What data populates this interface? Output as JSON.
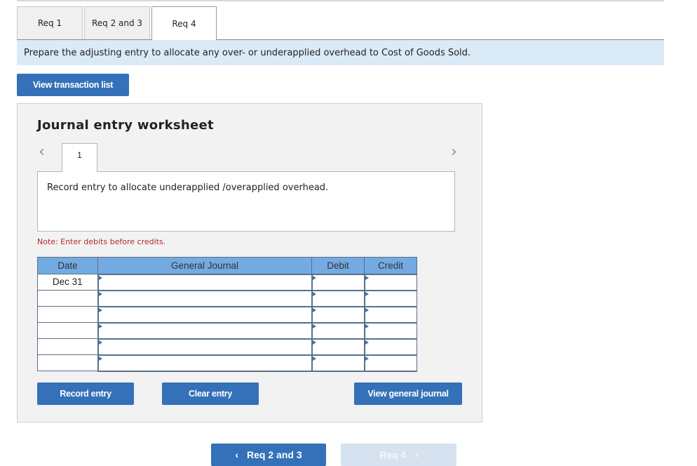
{
  "tabs": [
    {
      "label": "Req 1",
      "active": false
    },
    {
      "label": "Req 2 and 3",
      "active": false
    },
    {
      "label": "Req 4",
      "active": true
    }
  ],
  "prompt": "Prepare the adjusting entry to allocate any over- or underapplied overhead to Cost of Goods Sold.",
  "view_transaction_list_label": "View transaction list",
  "worksheet": {
    "title": "Journal entry worksheet",
    "prev_icon": "chevron-left-icon",
    "next_icon": "chevron-right-icon",
    "entry_tab": "1",
    "description": "Record entry to allocate underapplied /overapplied overhead.",
    "note": "Note: Enter debits before credits.",
    "columns": [
      "Date",
      "General Journal",
      "Debit",
      "Credit"
    ],
    "rows": [
      {
        "date": "Dec 31",
        "account": "",
        "debit": "",
        "credit": ""
      },
      {
        "date": "",
        "account": "",
        "debit": "",
        "credit": ""
      },
      {
        "date": "",
        "account": "",
        "debit": "",
        "credit": ""
      },
      {
        "date": "",
        "account": "",
        "debit": "",
        "credit": ""
      },
      {
        "date": "",
        "account": "",
        "debit": "",
        "credit": ""
      },
      {
        "date": "",
        "account": "",
        "debit": "",
        "credit": ""
      }
    ],
    "buttons": {
      "record": "Record entry",
      "clear": "Clear entry",
      "view_general_journal": "View general journal"
    }
  },
  "nav": {
    "prev_label": "Req 2 and 3",
    "next_label": "Req 4",
    "prev_chevron": "‹",
    "next_chevron": "›"
  },
  "colors": {
    "accent": "#3471b8",
    "header_blue": "#74aae2",
    "prompt_bg": "#dbeaf7",
    "note_red": "#b0282f",
    "disabled_nav": "#d6e2f0"
  }
}
